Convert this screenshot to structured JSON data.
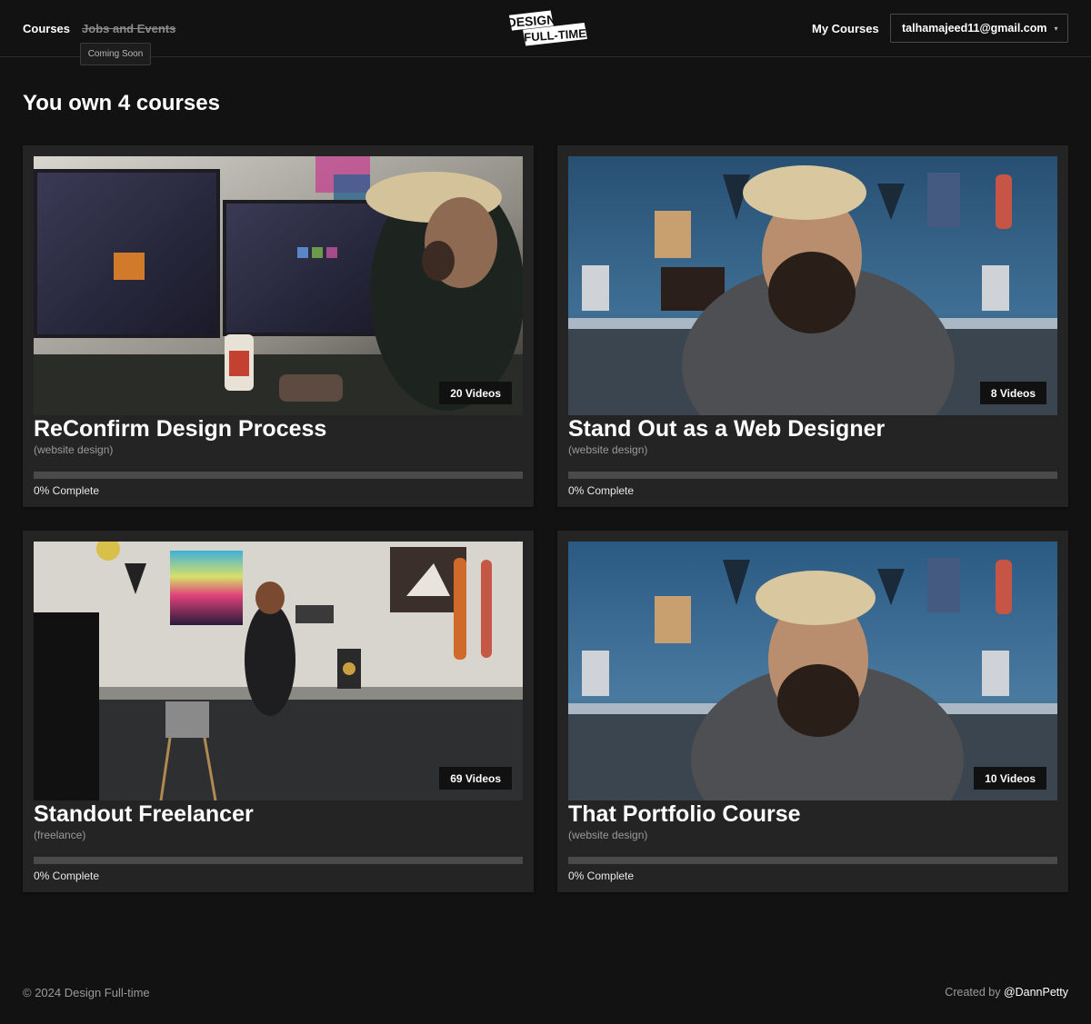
{
  "header": {
    "nav": [
      {
        "label": "Courses",
        "disabled": false
      },
      {
        "label": "Jobs and Events",
        "disabled": true
      }
    ],
    "tooltip": "Coming Soon",
    "logo_line1": "DESIGN",
    "logo_line2": "FULL-TIME",
    "my_courses": "My Courses",
    "account_email": "talhamajeed11@gmail.com"
  },
  "main": {
    "title": "You own 4 courses",
    "courses": [
      {
        "title": "ReConfirm Design Process",
        "category": "(website design)",
        "videos": "20 Videos",
        "progress_pct": 0,
        "progress_label": "0% Complete"
      },
      {
        "title": "Stand Out as a Web Designer",
        "category": "(website design)",
        "videos": "8 Videos",
        "progress_pct": 0,
        "progress_label": "0% Complete"
      },
      {
        "title": "Standout Freelancer",
        "category": "(freelance)",
        "videos": "69 Videos",
        "progress_pct": 0,
        "progress_label": "0% Complete"
      },
      {
        "title": "That Portfolio Course",
        "category": "(website design)",
        "videos": "10 Videos",
        "progress_pct": 0,
        "progress_label": "0% Complete"
      }
    ]
  },
  "footer": {
    "copyright": "© 2024 Design Full-time",
    "created_by": "Created by",
    "author_handle": "@DannPetty"
  },
  "colors": {
    "background": "#121212",
    "card": "#242424",
    "progress_track": "#4a4a4a"
  }
}
